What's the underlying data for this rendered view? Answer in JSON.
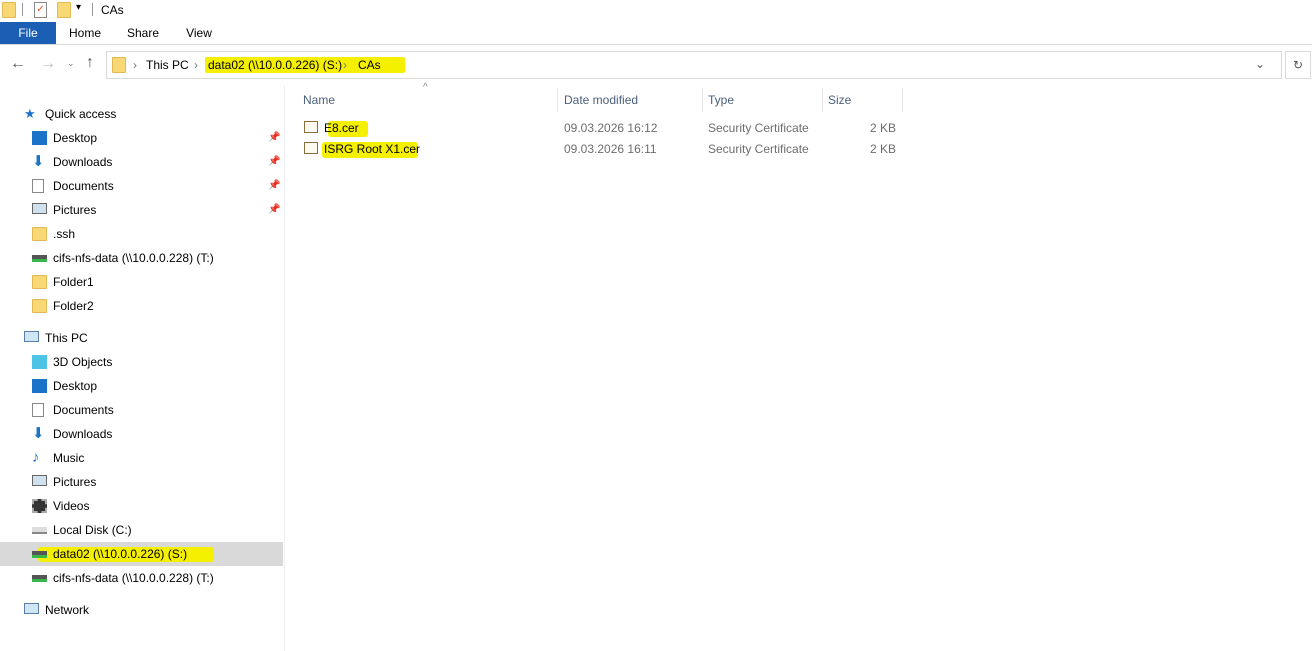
{
  "window": {
    "title": "CAs"
  },
  "ribbon": {
    "tabs": [
      "File",
      "Home",
      "Share",
      "View"
    ]
  },
  "address": {
    "crumbs": [
      "This PC",
      "data02 (\\\\10.0.0.226) (S:)",
      "CAs"
    ]
  },
  "columns": [
    "Name",
    "Date modified",
    "Type",
    "Size"
  ],
  "files": [
    {
      "name": "E8.cer",
      "date": "09.03.2026 16:12",
      "type": "Security Certificate",
      "size": "2 KB"
    },
    {
      "name": "ISRG Root X1.cer",
      "date": "09.03.2026 16:11",
      "type": "Security Certificate",
      "size": "2 KB"
    }
  ],
  "nav": {
    "quick_access": "Quick access",
    "quick_items": [
      "Desktop",
      "Downloads",
      "Documents",
      "Pictures",
      ".ssh",
      "cifs-nfs-data (\\\\10.0.0.228) (T:)",
      "Folder1",
      "Folder2"
    ],
    "this_pc": "This PC",
    "pc_items": [
      "3D Objects",
      "Desktop",
      "Documents",
      "Downloads",
      "Music",
      "Pictures",
      "Videos",
      "Local Disk (C:)",
      "data02 (\\\\10.0.0.226) (S:)",
      "cifs-nfs-data (\\\\10.0.0.228) (T:)"
    ],
    "network": "Network"
  },
  "colors": {
    "file_tab": "#1a5fb4",
    "highlight": "#f5f000",
    "selected": "#d9d9d9"
  }
}
